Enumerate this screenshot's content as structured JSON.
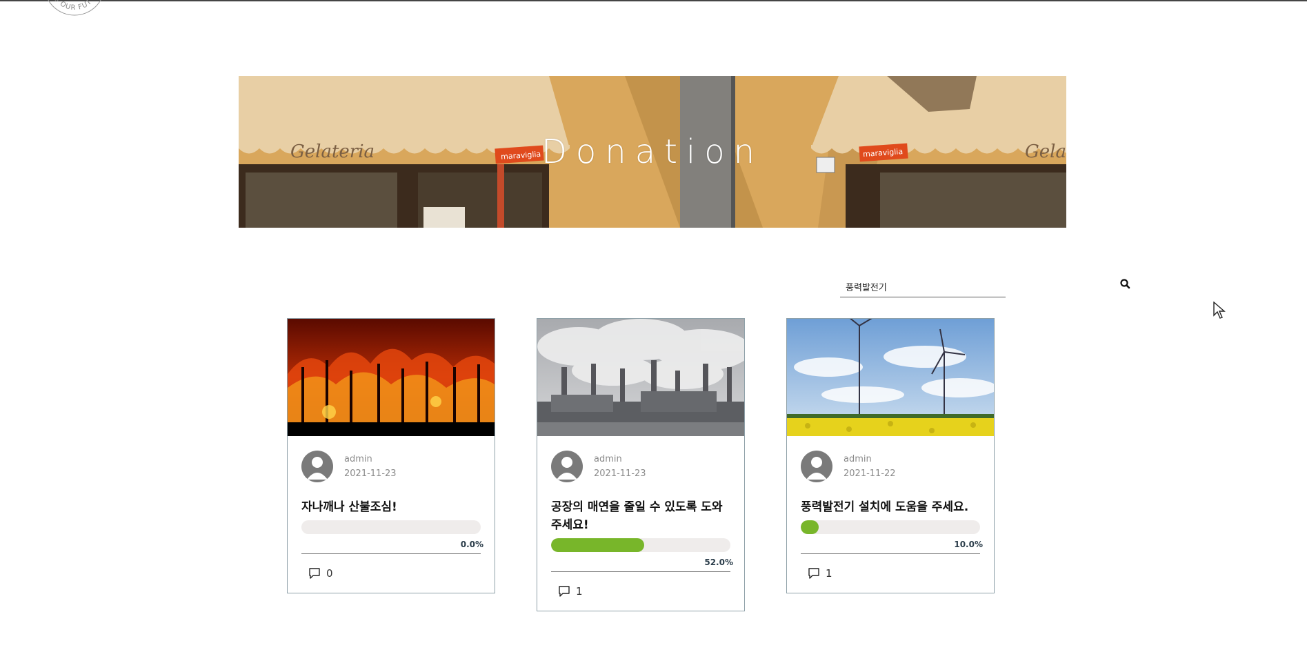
{
  "banner": {
    "title": "Donation"
  },
  "logo": {
    "text": "IS OUR FUT"
  },
  "search": {
    "value": "풍력발전기",
    "icon": "search-icon"
  },
  "cards": [
    {
      "author": "admin",
      "date": "2021-11-23",
      "title": "자나깨나 산불조심!",
      "progress": 0.0,
      "progress_label": "0.0%",
      "comments": "0",
      "image": "forest-fire"
    },
    {
      "author": "admin",
      "date": "2021-11-23",
      "title": "공장의 매연을 줄일 수 있도록 도와주세요!",
      "progress": 52.0,
      "progress_label": "52.0%",
      "comments": "1",
      "image": "factory-smoke"
    },
    {
      "author": "admin",
      "date": "2021-11-22",
      "title": "풍력발전기 설치에 도움을 주세요.",
      "progress": 10.0,
      "progress_label": "10.0%",
      "comments": "1",
      "image": "wind-turbines"
    }
  ],
  "colors": {
    "progress": "#78b62a",
    "track": "#efeceb",
    "card_border": "#8ea0a8"
  }
}
